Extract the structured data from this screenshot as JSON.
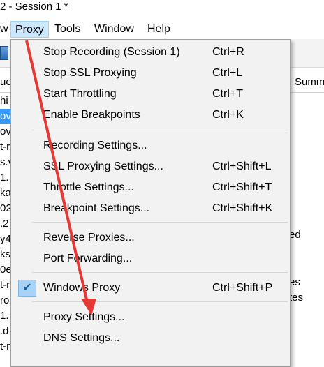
{
  "window": {
    "title": "2 - Session 1 *"
  },
  "menubar": {
    "items": [
      {
        "label": "w"
      },
      {
        "label": "Proxy"
      },
      {
        "label": "Tools"
      },
      {
        "label": "Window"
      },
      {
        "label": "Help"
      }
    ]
  },
  "background": {
    "column_header_left": "ue",
    "column_header_right": "Summ",
    "rows": [
      "hi",
      "ov",
      "ov",
      "t-r",
      "s.v",
      "1.",
      "ka.",
      "02",
      ".2",
      "y4",
      "ks",
      "0e",
      "t-r",
      "ro",
      "1.",
      ".d",
      "t-r"
    ],
    "selected_rows": [
      1
    ],
    "right_fragments": [
      "ed",
      "es",
      "tes"
    ]
  },
  "dropdown": {
    "groups": [
      [
        {
          "label": "Stop Recording (Session 1)",
          "shortcut": "Ctrl+R"
        },
        {
          "label": "Stop SSL Proxying",
          "shortcut": "Ctrl+L"
        },
        {
          "label": "Start Throttling",
          "shortcut": "Ctrl+T"
        },
        {
          "label": "Enable Breakpoints",
          "shortcut": "Ctrl+K"
        }
      ],
      [
        {
          "label": "Recording Settings...",
          "shortcut": ""
        },
        {
          "label": "SSL Proxying Settings...",
          "shortcut": "Ctrl+Shift+L"
        },
        {
          "label": "Throttle Settings...",
          "shortcut": "Ctrl+Shift+T"
        },
        {
          "label": "Breakpoint Settings...",
          "shortcut": "Ctrl+Shift+K"
        }
      ],
      [
        {
          "label": "Reverse Proxies...",
          "shortcut": ""
        },
        {
          "label": "Port Forwarding...",
          "shortcut": ""
        }
      ],
      [
        {
          "label": "Windows Proxy",
          "shortcut": "Ctrl+Shift+P",
          "checked": true
        }
      ],
      [
        {
          "label": "Proxy Settings...",
          "shortcut": ""
        },
        {
          "label": "DNS Settings...",
          "shortcut": ""
        }
      ]
    ]
  },
  "colors": {
    "menu_highlight": "#cce8ff",
    "selection": "#3399ff",
    "arrow": "#e53935",
    "check_box": "#a8d3f7"
  },
  "annotations": [
    {
      "type": "arrow",
      "target": "Proxy Settings..."
    }
  ]
}
